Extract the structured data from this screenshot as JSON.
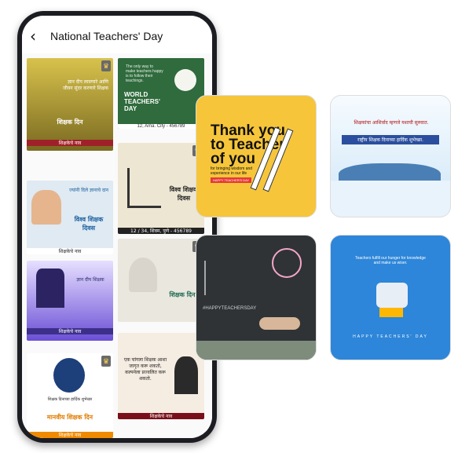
{
  "header": {
    "back_icon": "chevron-left-icon",
    "title": "National Teachers' Day"
  },
  "tiles": {
    "t1": {
      "text": "ज्ञान दीप लावणारे आणि जीवन सुंदर करणारे शिक्षक",
      "label": "शिक्षक दिन",
      "footer": "शिक्षकेचे नाव"
    },
    "t2": {
      "text": "The only way to make teachers happy is to follow their teachings.",
      "headline": "WORLD TEACHERS' DAY",
      "footer": "12, Ama. City - 456789"
    },
    "t3": {
      "text": "ज्यांनी दिले ज्ञानाचे दान",
      "label": "विश्व शिक्षक दिवस",
      "footer": "शिक्षकेचे नाव"
    },
    "t4": {
      "label": "विश्व शिक्षक दिवस",
      "footer": "12 / 34, शिवम, पुणे - 456789"
    },
    "t5": {
      "text": "ज्ञान दीप शिक्षक",
      "label": "शिक्षक दिन",
      "footer": "शिक्षकेचे नाव"
    },
    "t6": {
      "label": "शिक्षक दिन"
    },
    "t7": {
      "text": "शिक्षक दिनाच्या हार्दिक शुभेच्छा",
      "label": "मानवीय शिक्षक दिन",
      "footer": "शिक्षकेचे नाव"
    },
    "t8": {
      "text": "एक चांगला शिक्षक आशा जागृत करू शकतो, कल्पनेला प्रज्वलित करू शकतो.",
      "footer": "शिक्षकेचे नाव"
    }
  },
  "cards": {
    "yellow": {
      "line1": "Thank you",
      "line2": "to Teacher",
      "line3": "of you",
      "sub": "for bringing wisdom and experience in our life",
      "tag": "HAPPY TEACHER'S DAY"
    },
    "mountain": {
      "line1": "शिक्षकांचा आशिर्वाद म्हणजे यशाची सुरुवात.",
      "line2": "राष्ट्रीय शिक्षक दिनाच्या हार्दिक शुभेच्छा."
    },
    "chalk": {
      "text": "#HAPPYTEACHERSDAY"
    },
    "blue": {
      "quote": "Teachers fulfill our hunger for knowledge and make us wiser.",
      "footer": "HAPPY TEACHERS' DAY"
    }
  }
}
